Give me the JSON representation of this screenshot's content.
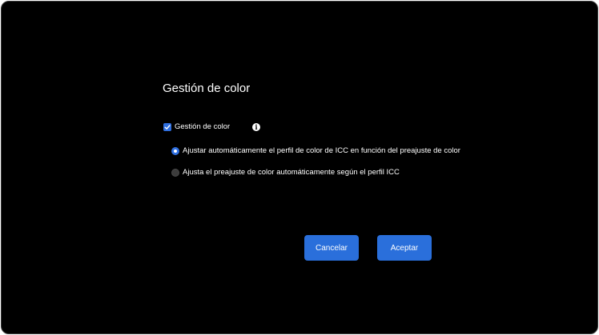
{
  "dialog": {
    "title": "Gestión de color"
  },
  "color_management": {
    "checkbox_label": "Gestión de color",
    "checked": true,
    "info_icon": "info-icon"
  },
  "options": [
    {
      "label": "Ajustar automáticamente el perfil de color de ICC en función del preajuste de color",
      "selected": true
    },
    {
      "label": "Ajusta el preajuste de color automáticamente según el perfil ICC",
      "selected": false
    }
  ],
  "buttons": {
    "cancel_label": "Cancelar",
    "accept_label": "Aceptar"
  },
  "colors": {
    "accent": "#2a6fdb",
    "background": "#000000",
    "text": "#ffffff"
  }
}
